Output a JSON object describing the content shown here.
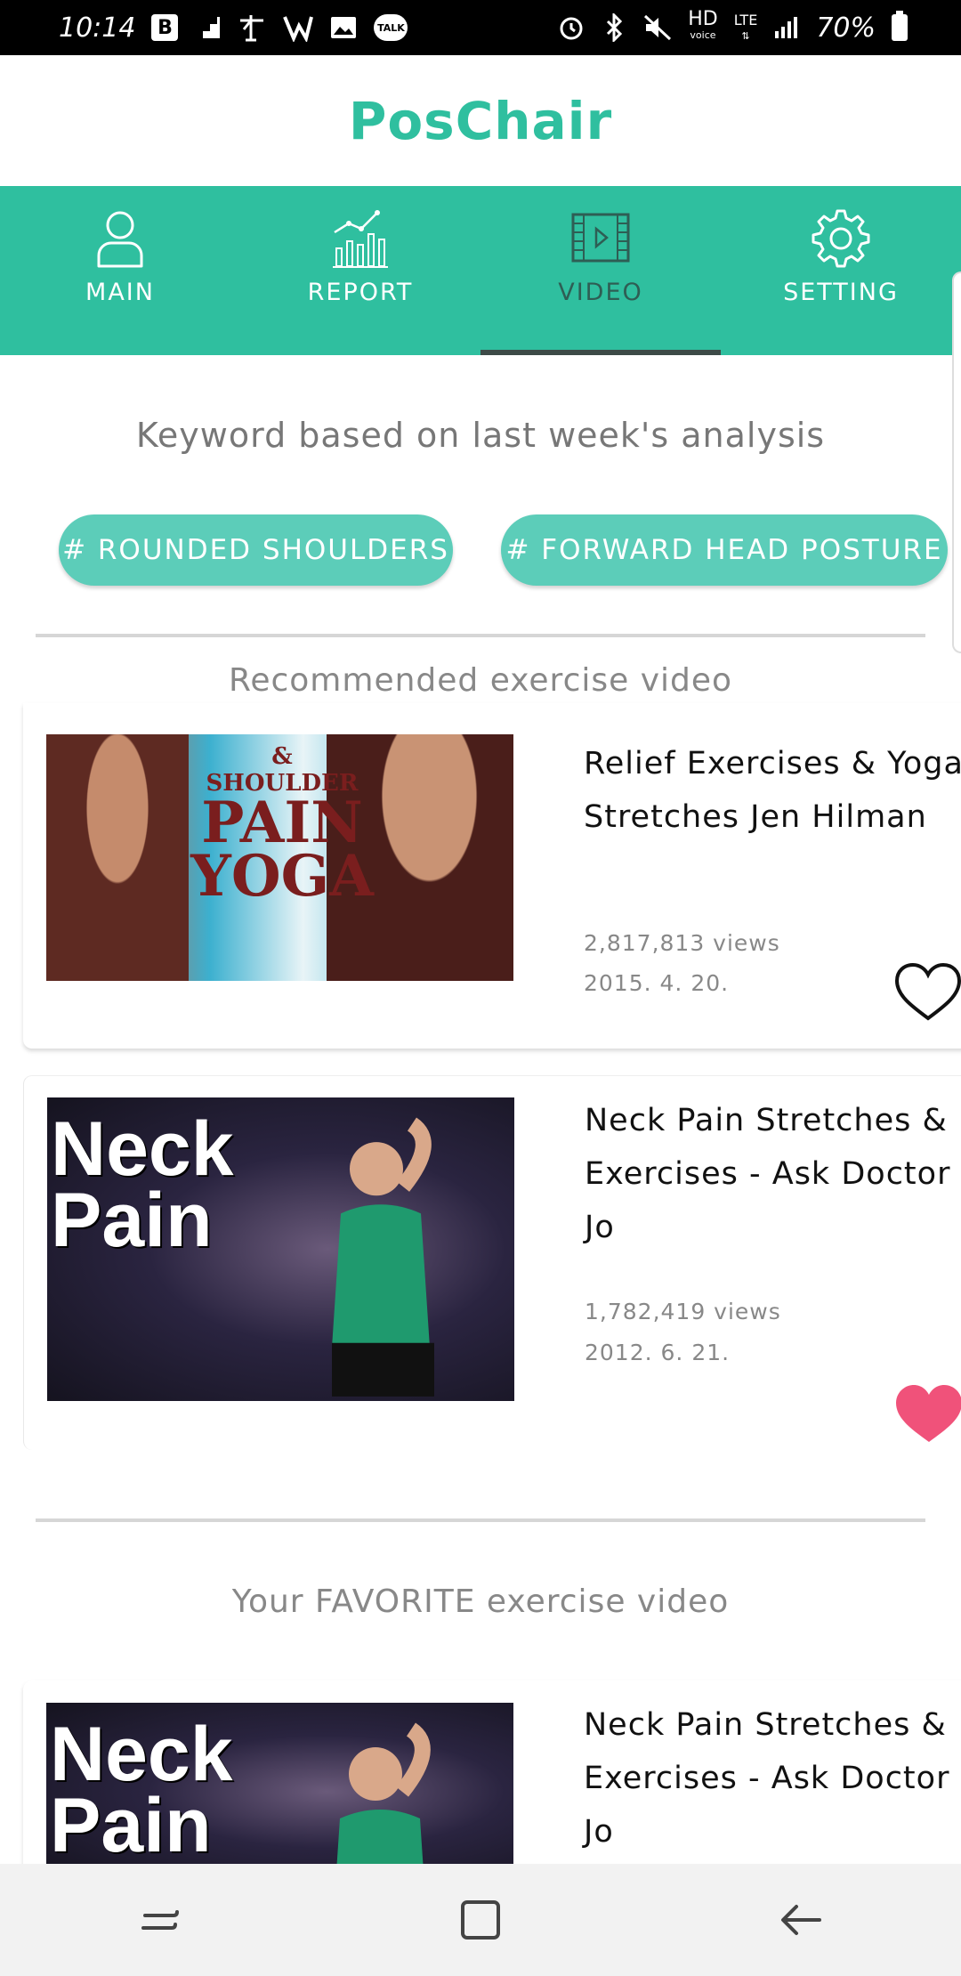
{
  "status_bar": {
    "time": "10:14",
    "hd": "HD",
    "voice": "voice",
    "lte": "LTE",
    "battery": "70%",
    "talk": "TALK",
    "b": "B"
  },
  "app": {
    "title": "PosChair"
  },
  "tabs": [
    {
      "label": "MAIN",
      "icon": "person-icon"
    },
    {
      "label": "REPORT",
      "icon": "bar-chart-icon"
    },
    {
      "label": "VIDEO",
      "icon": "film-icon",
      "active": true
    },
    {
      "label": "SETTING",
      "icon": "gear-icon"
    }
  ],
  "keywords": {
    "title": "Keyword based on last week's analysis",
    "chips": [
      "# ROUNDED SHOULDERS",
      "# FORWARD HEAD POSTURE"
    ]
  },
  "recommended": {
    "title": "Recommended exercise video",
    "videos": [
      {
        "title": "Relief Exercises & Yoga Stretches Jen Hilman",
        "views": "2,817,813 views",
        "date": "2015. 4. 20.",
        "favorited": false,
        "thumb_text": [
          "&",
          "SHOULDER",
          "PAIN",
          "YOGA"
        ]
      },
      {
        "title": "Neck Pain Stretches & Exercises - Ask Doctor Jo",
        "views": "1,782,419 views",
        "date": "2012. 6. 21.",
        "favorited": true,
        "thumb_text": [
          "Neck",
          "Pain"
        ]
      }
    ]
  },
  "favorites": {
    "title": "Your FAVORITE exercise video",
    "videos": [
      {
        "title": "Neck Pain Stretches & Exercises - Ask Doctor Jo",
        "thumb_text": [
          "Neck",
          "Pain"
        ]
      }
    ]
  },
  "colors": {
    "brand": "#2fbf9f",
    "chip": "#5ccdb9",
    "heart_filled": "#f0527a"
  }
}
